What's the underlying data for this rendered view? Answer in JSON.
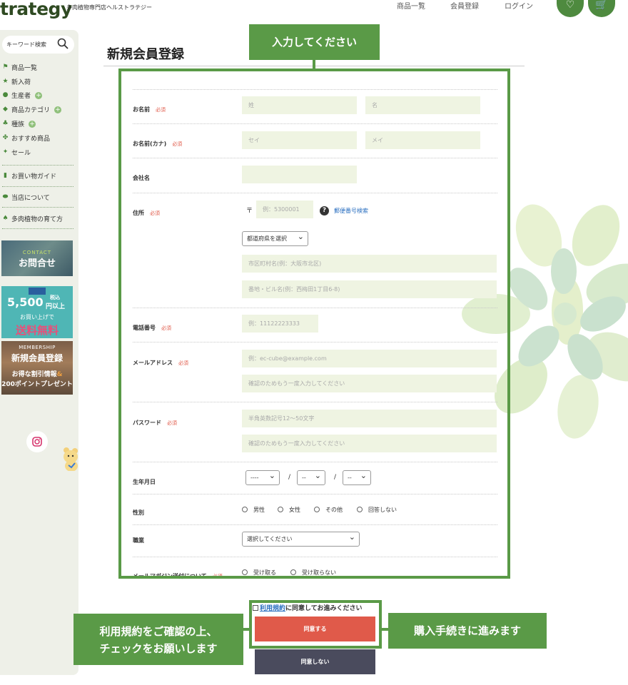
{
  "header": {
    "logo": "trategy",
    "tagline": "多肉植物専門店ヘルストラテジー",
    "nav": [
      "商品一覧",
      "会員登録",
      "ログイン"
    ]
  },
  "sidebar": {
    "search_placeholder": "キーワード検索",
    "menu": [
      {
        "label": "商品一覧",
        "icon": "flag-icon",
        "plus": false
      },
      {
        "label": "新入荷",
        "icon": "star-icon",
        "plus": false
      },
      {
        "label": "生産者",
        "icon": "farmer-icon",
        "plus": true
      },
      {
        "label": "商品カテゴリ",
        "icon": "tag-icon",
        "plus": true
      },
      {
        "label": "種族",
        "icon": "plant-icon",
        "plus": true
      },
      {
        "label": "おすすめ商品",
        "icon": "clover-icon",
        "plus": false
      },
      {
        "label": "セール",
        "icon": "sparkle-icon",
        "plus": false
      }
    ],
    "guide": "お買い物ガイド",
    "about": "当店について",
    "howto": "多肉植物の育て方",
    "banner_contact_small": "CONTACT",
    "banner_contact": "お問合せ",
    "banner_ship_tax": "税込",
    "banner_ship_amount": "5,500",
    "banner_ship_unit": "円以上",
    "banner_ship_line": "お買い上げで",
    "banner_ship_free": "送料無料",
    "banner_member_small": "MEMBERSHIP",
    "banner_member_title": "新規会員登録",
    "banner_member_line1": "お得な割引情報",
    "banner_member_amp": "&",
    "banner_member_line2": "200ポイントプレゼント"
  },
  "form": {
    "title": "新規会員登録",
    "required": "必須",
    "name_label": "お名前",
    "name_last_ph": "姓",
    "name_first_ph": "名",
    "kana_label": "お名前(カナ)",
    "kana_last_ph": "セイ",
    "kana_first_ph": "メイ",
    "company_label": "会社名",
    "address_label": "住所",
    "postal_mark": "〒",
    "postal_ph": "例：5300001",
    "postal_search": "郵便番号検索",
    "pref_select": "都道府県を選択",
    "city_ph": "市区町村名(例：大阪市北区)",
    "street_ph": "番地・ビル名(例：西梅田1丁目6-8)",
    "phone_label": "電話番号",
    "phone_ph": "例：11122223333",
    "email_label": "メールアドレス",
    "email_ph": "例：ec-cube@example.com",
    "email_confirm_ph": "確認のためもう一度入力してください",
    "password_label": "パスワード",
    "password_ph": "半角英数記号12〜50文字",
    "password_confirm_ph": "確認のためもう一度入力してください",
    "birth_label": "生年月日",
    "birth_year": "----",
    "birth_month": "--",
    "birth_day": "--",
    "slash": "/",
    "gender_label": "性別",
    "genders": [
      "男性",
      "女性",
      "その他",
      "回答しない"
    ],
    "job_label": "職業",
    "job_select": "選択してください",
    "mail_label": "メールマガジン送付について",
    "mail_options": [
      "受け取る",
      "受け取らない"
    ],
    "terms_link": "利用規約",
    "terms_rest": "に同意してお進みください",
    "agree": "同意する",
    "disagree": "同意しない"
  },
  "callouts": {
    "input": "入力してください",
    "check_line1": "利用規約をご確認の上、",
    "check_line2": "チェックをお願いします",
    "proceed": "購入手続きに進みます"
  },
  "colors": {
    "accent_green": "#5a9a47",
    "field_bg": "#eff4e2",
    "agree_red": "#e05a4a",
    "disagree_dark": "#4a4b5d",
    "required_red": "#e05a4a"
  }
}
